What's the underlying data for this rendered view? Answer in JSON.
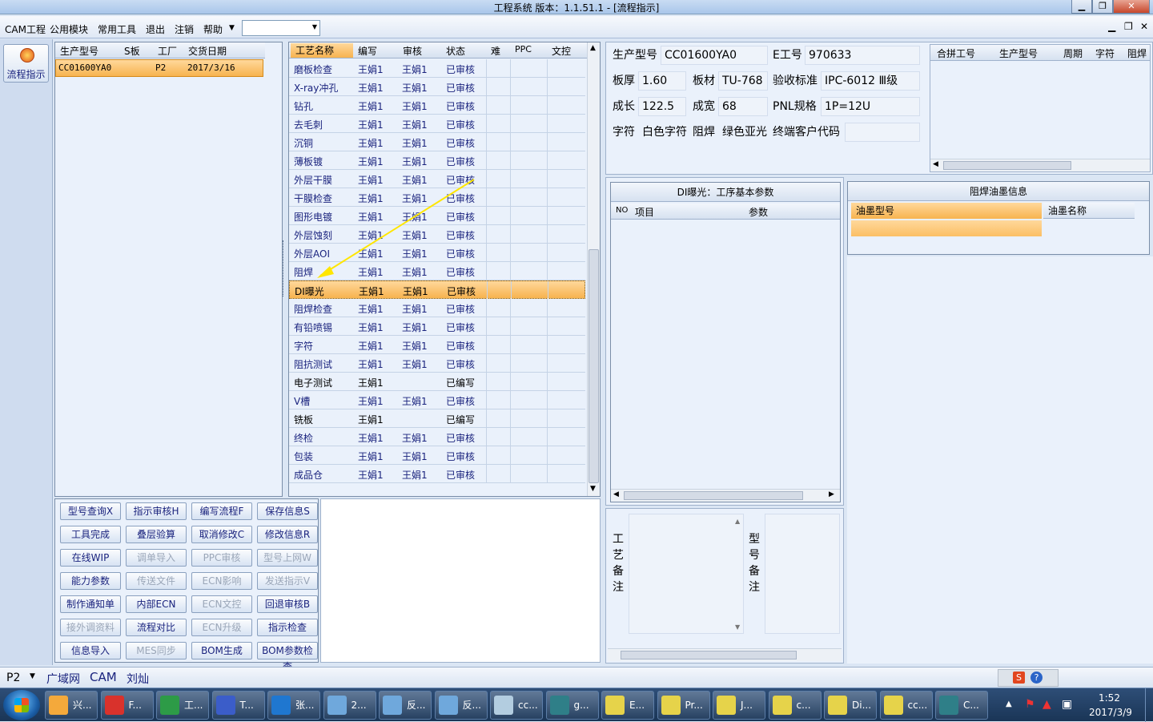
{
  "window": {
    "title": "工程系统   版本：1.1.51.1 - [流程指示]"
  },
  "menu": {
    "items": [
      "CAM工程",
      "公用模块",
      "常用工具",
      "退出",
      "注销",
      "帮助"
    ],
    "combo_value": ""
  },
  "sidebar": {
    "button_label": "流程指示"
  },
  "models": {
    "headers": [
      "生产型号",
      "S板",
      "工厂",
      "交货日期"
    ],
    "rows": [
      {
        "model": "CC01600YA0",
        "s": "",
        "factory": "P2",
        "date": "2017/3/16"
      }
    ]
  },
  "process": {
    "headers": [
      "工艺名称",
      "编写",
      "审核",
      "状态",
      "难",
      "PPC",
      "文控"
    ],
    "rows": [
      {
        "name": "磨板检查",
        "writer": "王娟1",
        "reviewer": "王娟1",
        "status": "已审核"
      },
      {
        "name": "X-ray冲孔",
        "writer": "王娟1",
        "reviewer": "王娟1",
        "status": "已审核"
      },
      {
        "name": "钻孔",
        "writer": "王娟1",
        "reviewer": "王娟1",
        "status": "已审核"
      },
      {
        "name": "去毛刺",
        "writer": "王娟1",
        "reviewer": "王娟1",
        "status": "已审核"
      },
      {
        "name": "沉铜",
        "writer": "王娟1",
        "reviewer": "王娟1",
        "status": "已审核"
      },
      {
        "name": "薄板镀",
        "writer": "王娟1",
        "reviewer": "王娟1",
        "status": "已审核"
      },
      {
        "name": "外层干膜",
        "writer": "王娟1",
        "reviewer": "王娟1",
        "status": "已审核"
      },
      {
        "name": "干膜检查",
        "writer": "王娟1",
        "reviewer": "王娟1",
        "status": "已审核"
      },
      {
        "name": "图形电镀",
        "writer": "王娟1",
        "reviewer": "王娟1",
        "status": "已审核"
      },
      {
        "name": "外层蚀刻",
        "writer": "王娟1",
        "reviewer": "王娟1",
        "status": "已审核"
      },
      {
        "name": "外层AOI",
        "writer": "王娟1",
        "reviewer": "王娟1",
        "status": "已审核"
      },
      {
        "name": "阻焊",
        "writer": "王娟1",
        "reviewer": "王娟1",
        "status": "已审核"
      },
      {
        "name": "DI曝光",
        "writer": "王娟1",
        "reviewer": "王娟1",
        "status": "已审核",
        "selected": true
      },
      {
        "name": "阻焊检查",
        "writer": "王娟1",
        "reviewer": "王娟1",
        "status": "已审核"
      },
      {
        "name": "有铅喷锡",
        "writer": "王娟1",
        "reviewer": "王娟1",
        "status": "已审核"
      },
      {
        "name": "字符",
        "writer": "王娟1",
        "reviewer": "王娟1",
        "status": "已审核"
      },
      {
        "name": "阻抗测试",
        "writer": "王娟1",
        "reviewer": "王娟1",
        "status": "已审核"
      },
      {
        "name": "电子测试",
        "writer": "王娟1",
        "reviewer": "",
        "status": "已编写",
        "plain": true
      },
      {
        "name": "V槽",
        "writer": "王娟1",
        "reviewer": "王娟1",
        "status": "已审核"
      },
      {
        "name": "铣板",
        "writer": "王娟1",
        "reviewer": "",
        "status": "已编写",
        "plain": true
      },
      {
        "name": "终检",
        "writer": "王娟1",
        "reviewer": "王娟1",
        "status": "已审核"
      },
      {
        "name": "包装",
        "writer": "王娟1",
        "reviewer": "王娟1",
        "status": "已审核"
      },
      {
        "name": "成品仓",
        "writer": "王娟1",
        "reviewer": "王娟1",
        "status": "已审核"
      }
    ]
  },
  "buttons": [
    {
      "label": "型号查询X",
      "enabled": true
    },
    {
      "label": "指示审核H",
      "enabled": true
    },
    {
      "label": "编写流程F",
      "enabled": true
    },
    {
      "label": "保存信息S",
      "enabled": true
    },
    {
      "label": "工具完成",
      "enabled": true
    },
    {
      "label": "叠层验算",
      "enabled": true
    },
    {
      "label": "取消修改C",
      "enabled": true
    },
    {
      "label": "修改信息R",
      "enabled": true
    },
    {
      "label": "在线WIP",
      "enabled": true
    },
    {
      "label": "调单导入",
      "enabled": false
    },
    {
      "label": "PPC审核",
      "enabled": false
    },
    {
      "label": "型号上网W",
      "enabled": false
    },
    {
      "label": "能力参数",
      "enabled": true
    },
    {
      "label": "传送文件",
      "enabled": false
    },
    {
      "label": "ECN影响",
      "enabled": false
    },
    {
      "label": "发送指示V",
      "enabled": false
    },
    {
      "label": "制作通知单",
      "enabled": true
    },
    {
      "label": "内部ECN",
      "enabled": true
    },
    {
      "label": "ECN文控",
      "enabled": false
    },
    {
      "label": "回退审核B",
      "enabled": true
    },
    {
      "label": "接外调资料",
      "enabled": false
    },
    {
      "label": "流程对比",
      "enabled": true
    },
    {
      "label": "ECN升级",
      "enabled": false
    },
    {
      "label": "指示检查",
      "enabled": true
    },
    {
      "label": "信息导入",
      "enabled": true
    },
    {
      "label": "MES同步",
      "enabled": false
    },
    {
      "label": "BOM生成",
      "enabled": true
    },
    {
      "label": "BOM参数检查",
      "enabled": true
    }
  ],
  "info": {
    "model_label": "生产型号",
    "model_value": "CC01600YA0",
    "e_label": "E工号",
    "e_value": "970633",
    "thick_label": "板厚",
    "thick_value": "1.60",
    "material_label": "板材",
    "material_value": "TU-768",
    "std_label": "验收标准",
    "std_value": "IPC-6012 Ⅲ级",
    "len_label": "成长",
    "len_value": "122.5",
    "wid_label": "成宽",
    "wid_value": "68",
    "pnl_label": "PNL规格",
    "pnl_value": "1P=12U",
    "char_label": "字符",
    "char_value": "白色字符",
    "mask_label": "阻焊",
    "mask_value": "绿色亚光",
    "cust_label": "终端客户代码",
    "cust_value": ""
  },
  "merge": {
    "headers": [
      "合拼工号",
      "生产型号",
      "周期",
      "字符",
      "阻焊"
    ]
  },
  "params": {
    "title": "DI曝光：工序基本参数",
    "headers": [
      "NO",
      "项目",
      "参数"
    ]
  },
  "ink": {
    "title": "阻焊油墨信息",
    "headers": [
      "油墨型号",
      "油墨名称"
    ]
  },
  "remarks": {
    "process_label": "工艺备注",
    "model_label": "型号备注"
  },
  "statusbar": {
    "factory": "P2",
    "items": [
      "广域网",
      "CAM",
      "刘灿"
    ]
  },
  "taskbar": {
    "items": [
      "兴...",
      "F...",
      "工...",
      "T...",
      "张...",
      "2...",
      "反...",
      "反...",
      "cc...",
      "g...",
      "E...",
      "Pr...",
      "J...",
      "c...",
      "Di...",
      "cc...",
      "C..."
    ],
    "time": "1:52",
    "date": "2017/3/9"
  },
  "colors": {
    "accent": "#f7b34f",
    "link": "#1a237e",
    "titlebar": "#a9c6ea"
  }
}
